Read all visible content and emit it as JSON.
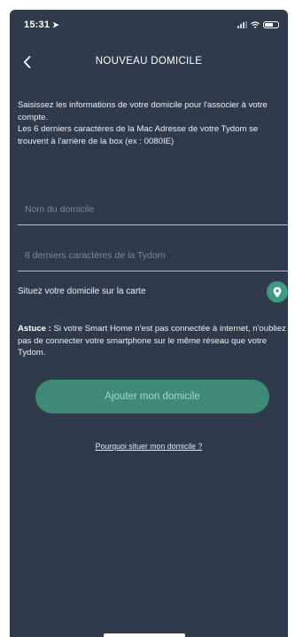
{
  "status_bar": {
    "time": "15:31",
    "location_icon": "location-arrow-icon",
    "signal_icon": "cellular-signal-icon",
    "wifi_icon": "wifi-icon",
    "battery_icon": "battery-icon",
    "battery_level": 0.7
  },
  "nav": {
    "back_icon": "chevron-left-icon",
    "title": "NOUVEAU DOMICILE"
  },
  "intro": {
    "text": "Saisissez les informations de votre domicile pour l'associer à votre compte.\nLes 6 derniers caractères de la Mac Adresse de votre Tydom se trouvent à l'arrière de la box (ex : 0080IE)"
  },
  "form": {
    "home_name_placeholder": "Nom du domicile",
    "tydom_code_placeholder": "6 derniers caractères de la Tydom",
    "home_name_value": "",
    "tydom_code_value": ""
  },
  "location": {
    "label": "Situez votre domicile sur la carte",
    "icon": "map-pin-icon"
  },
  "tip": {
    "prefix": "Astuce :",
    "text": " Si votre Smart Home n'est pas connectée à internet, n'oubliez pas de connecter votre smartphone sur le même réseau que votre Tydom."
  },
  "actions": {
    "add_home_label": "Ajouter mon domicile",
    "why_link": "Pourquoi situer mon domicile ?"
  },
  "colors": {
    "background": "#2f3b4a",
    "accent": "#3f9a82",
    "button": "#3f8a75"
  }
}
